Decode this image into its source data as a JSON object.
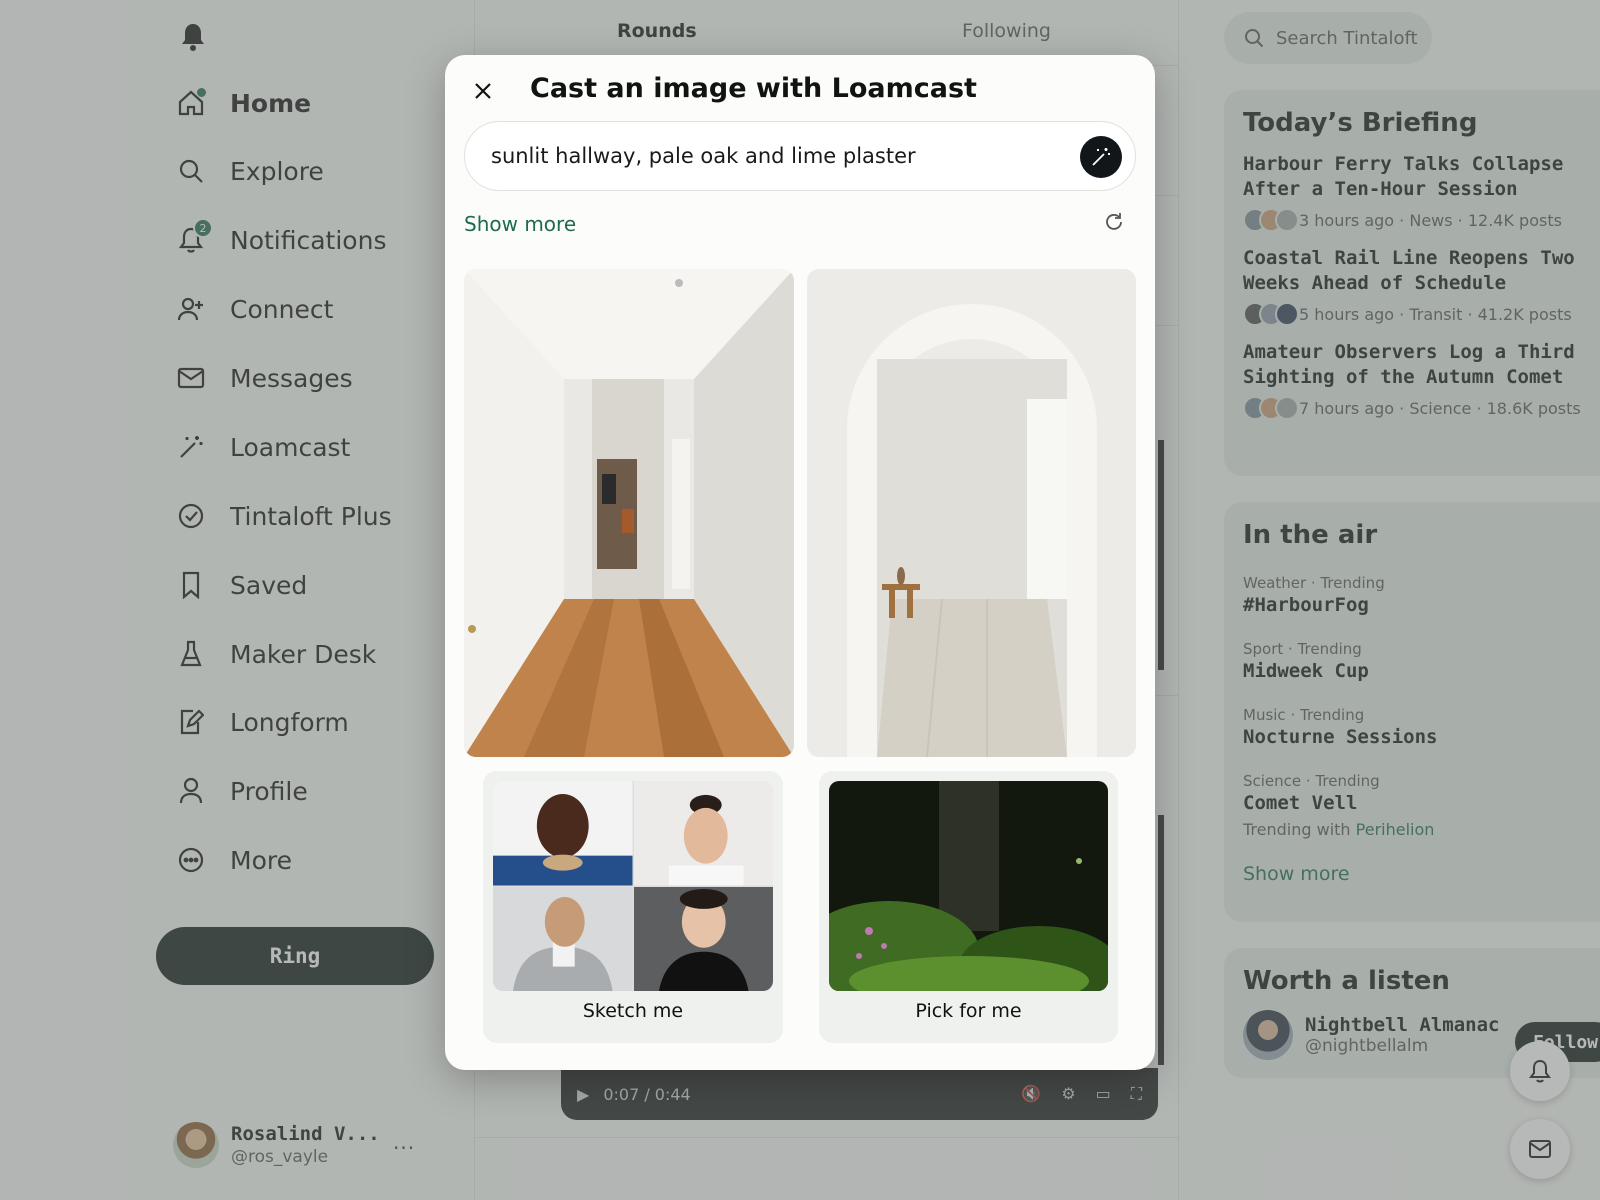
{
  "nav": {
    "items": [
      {
        "label": "Home",
        "icon": "home-icon",
        "active": true
      },
      {
        "label": "Explore",
        "icon": "search-icon"
      },
      {
        "label": "Notifications",
        "icon": "bell-icon",
        "badge": "2"
      },
      {
        "label": "Connect",
        "icon": "person-add-icon"
      },
      {
        "label": "Messages",
        "icon": "envelope-icon"
      },
      {
        "label": "Loamcast",
        "icon": "magic-wand-icon"
      },
      {
        "label": "Tintaloft Plus",
        "icon": "check-circle-icon"
      },
      {
        "label": "Saved",
        "icon": "bookmark-icon"
      },
      {
        "label": "Maker Desk",
        "icon": "flask-icon"
      },
      {
        "label": "Longform",
        "icon": "edit-document-icon"
      },
      {
        "label": "Profile",
        "icon": "person-icon"
      },
      {
        "label": "More",
        "icon": "more-circle-icon"
      }
    ],
    "ring_label": "Ring",
    "account": {
      "name": "Rosalind V...",
      "handle": "@ros_vayle",
      "more": "..."
    }
  },
  "feed": {
    "tabs": [
      "Rounds",
      "Following"
    ],
    "video": {
      "time": "0:07 / 0:44"
    }
  },
  "search": {
    "placeholder": "Search Tintaloft"
  },
  "briefing": {
    "title": "Today’s Briefing",
    "items": [
      {
        "headline": "Harbour Ferry Talks Collapse After a Ten-Hour Session",
        "meta": "3 hours ago · News · 12.4K posts"
      },
      {
        "headline": "Coastal Rail Line Reopens Two Weeks Ahead of Schedule",
        "meta": "5 hours ago · Transit · 41.2K posts"
      },
      {
        "headline": "Amateur Observers Log a Third Sighting of the Autumn Comet",
        "meta": "7 hours ago · Science · 18.6K posts"
      }
    ]
  },
  "in_the_air": {
    "title": "In the air",
    "trends": [
      {
        "category": "Weather · Trending",
        "name": "#HarbourFog"
      },
      {
        "category": "Sport · Trending",
        "name": "Midweek Cup"
      },
      {
        "category": "Music · Trending",
        "name": "Nocturne Sessions"
      },
      {
        "category": "Science · Trending",
        "name": "Comet Vell",
        "with_prefix": "Trending with",
        "with_link": "Perihelion"
      }
    ],
    "show_more": "Show more"
  },
  "listen": {
    "title": "Worth a listen",
    "name": "Nightbell Almanac",
    "handle": "@nightbellalm",
    "follow": "Follow"
  },
  "modal": {
    "title": "Cast an image with Loamcast",
    "prompt_value": "sunlit hallway, pale oak and lime plaster",
    "show_more": "Show more",
    "options": [
      {
        "label": "Sketch me"
      },
      {
        "label": "Pick for me"
      }
    ]
  },
  "colors": {
    "accent": "#1d6b4c",
    "dark_button": "#0f1a16",
    "card_bg": "#e3ebe6"
  }
}
